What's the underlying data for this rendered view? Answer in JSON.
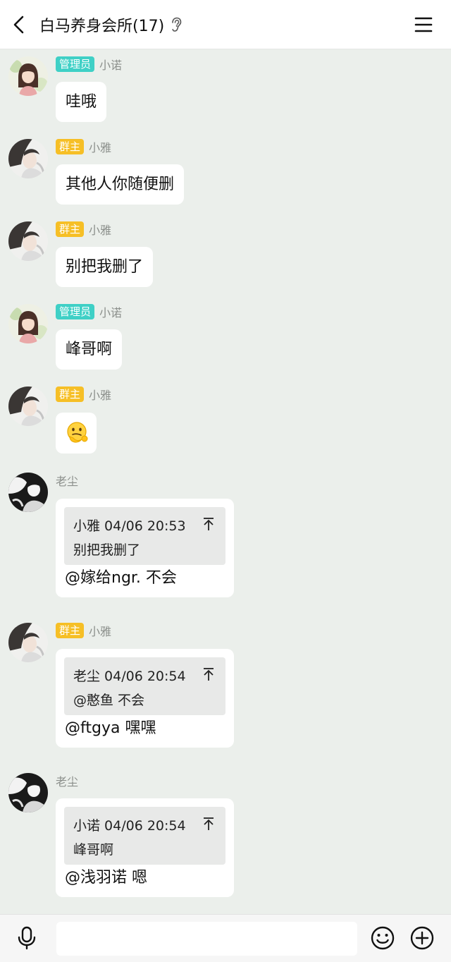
{
  "header": {
    "title": "白马养身会所(17)"
  },
  "messages": [
    {
      "role": "管理员",
      "name": "小诺",
      "text": "哇哦"
    },
    {
      "role": "群主",
      "name": "小雅",
      "text": "其他人你随便删"
    },
    {
      "role": "群主",
      "name": "小雅",
      "text": "别把我删了"
    },
    {
      "role": "管理员",
      "name": "小诺",
      "text": "峰哥啊"
    },
    {
      "role": "群主",
      "name": "小雅",
      "sticker": "thinking-sticker"
    },
    {
      "name": "老尘",
      "quote": {
        "header": "小雅 04/06 20:53",
        "body": "别把我删了"
      },
      "text": "@嫁给ngr. 不会"
    },
    {
      "role": "群主",
      "name": "小雅",
      "quote": {
        "header": "老尘 04/06 20:54",
        "body": "@憨鱼 不会"
      },
      "text": "@ftgya 嘿嘿"
    },
    {
      "name": "老尘",
      "quote": {
        "header": "小诺 04/06 20:54",
        "body": "峰哥啊"
      },
      "text": "@浅羽诺 嗯"
    }
  ],
  "input": {
    "value": "",
    "placeholder": ""
  },
  "colors": {
    "admin_badge": "#3fd0c6",
    "owner_badge": "#f6bf26",
    "chat_background": "#ebefeb"
  },
  "icons": [
    "back-icon",
    "ear-icon",
    "menu-icon",
    "pin-top-icon",
    "microphone-icon",
    "emoji-icon",
    "plus-icon"
  ]
}
